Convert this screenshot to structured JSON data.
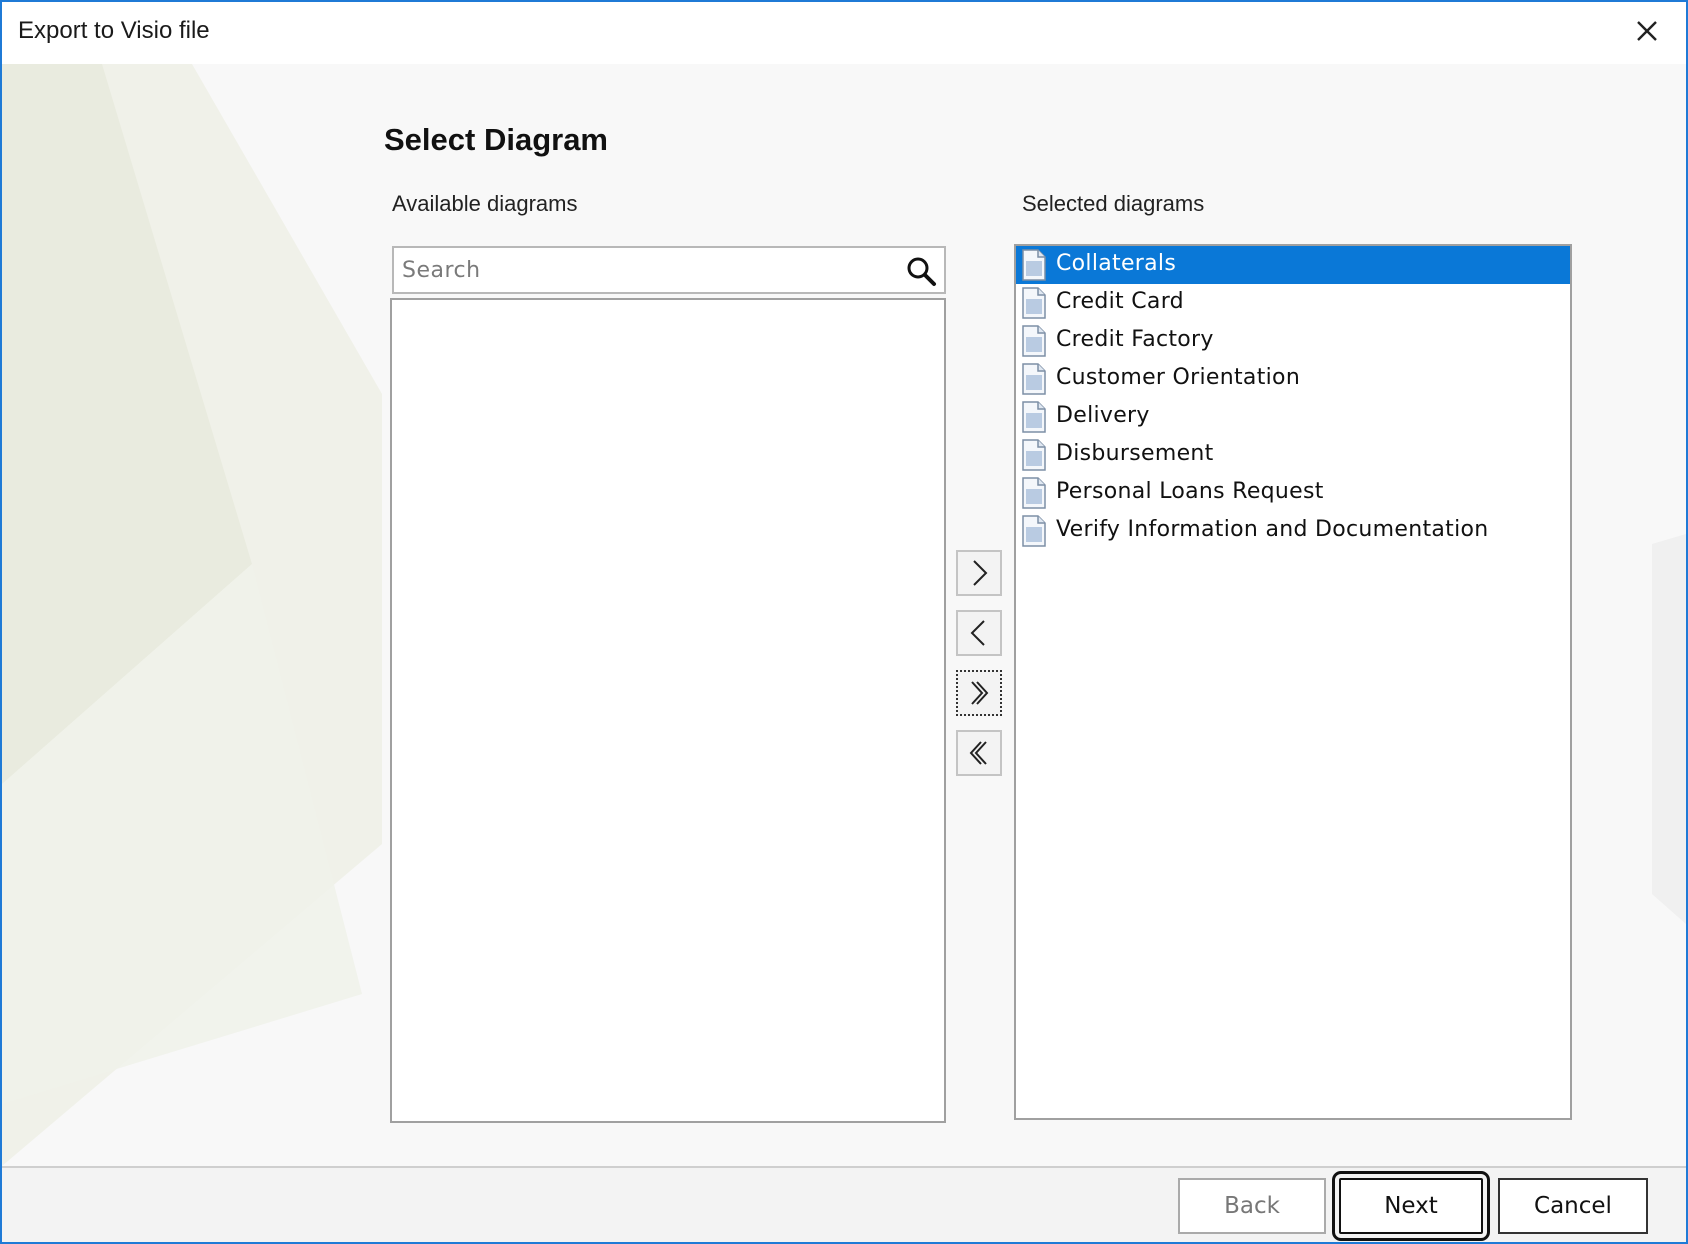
{
  "window": {
    "title": "Export to Visio file"
  },
  "page": {
    "heading": "Select Diagram"
  },
  "available": {
    "label": "Available diagrams",
    "search_placeholder": "Search",
    "items": []
  },
  "selected": {
    "label": "Selected diagrams",
    "items": [
      {
        "label": "Collaterals",
        "selected": true
      },
      {
        "label": "Credit Card",
        "selected": false
      },
      {
        "label": "Credit Factory",
        "selected": false
      },
      {
        "label": "Customer Orientation",
        "selected": false
      },
      {
        "label": "Delivery",
        "selected": false
      },
      {
        "label": "Disbursement",
        "selected": false
      },
      {
        "label": "Personal Loans Request",
        "selected": false
      },
      {
        "label": "Verify Information and Documentation",
        "selected": false
      }
    ]
  },
  "transfer_buttons": {
    "add": "chevron-right-icon",
    "remove": "chevron-left-icon",
    "add_all": "double-chevron-right-icon",
    "remove_all": "double-chevron-left-icon"
  },
  "footer": {
    "back": "Back",
    "next": "Next",
    "cancel": "Cancel"
  },
  "colors": {
    "accent": "#0a78d7",
    "border": "#1f7ad6"
  }
}
